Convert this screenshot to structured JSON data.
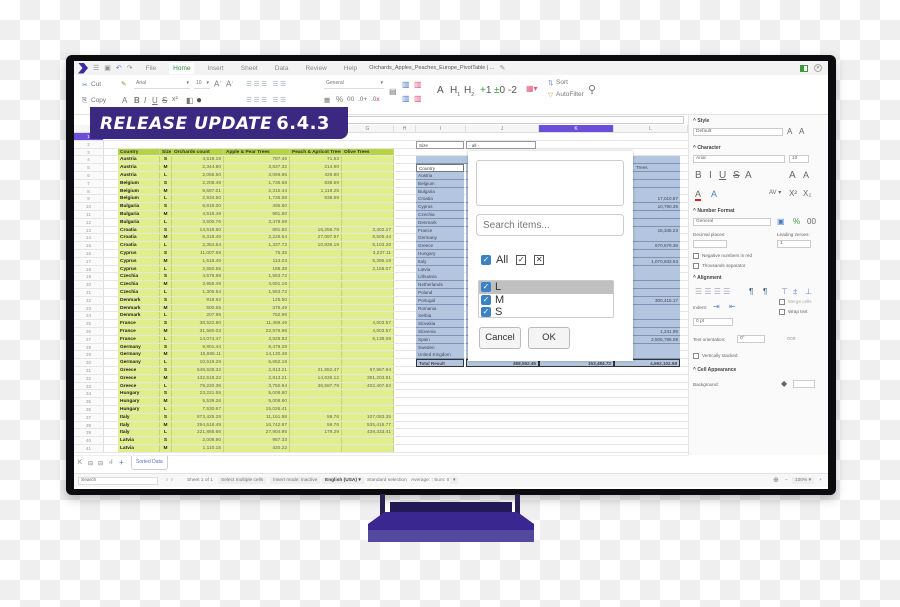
{
  "banner": {
    "text": "RELEASE UPDATE",
    "version": "6.4.3"
  },
  "menubar": {
    "tabs": [
      "File",
      "Home",
      "Insert",
      "Sheet",
      "Data",
      "Review",
      "Help"
    ],
    "active_tab": "Home",
    "document_title": "Orchards_Apples_Peaches_Europe_PivotTable | ..."
  },
  "toolbar": {
    "cut": "Cut",
    "copy": "Copy",
    "font_name": "Arial",
    "font_size": "10",
    "number_format": "General",
    "percent": "%",
    "decimals": ".00",
    "add_dec": ".0",
    "rem_dec": ".00",
    "heading_a": "A",
    "heading_h1": "H1",
    "heading_h2": "H2",
    "outline_plus": "+1",
    "outline_zero": "±0",
    "outline_minus": "-2",
    "sort": "Sort",
    "autofilter": "AutoFilter"
  },
  "columns": [
    "",
    "A",
    "B",
    "C",
    "D",
    "E",
    "F",
    "G",
    "H",
    "I",
    "J",
    "K",
    "L"
  ],
  "selected_column": "K",
  "data_table": {
    "headers": [
      "Country",
      "Size",
      "Orchards count",
      "Apple & Pear Trees",
      "Peach & Apricot Trees",
      "Olive Trees"
    ],
    "rows": [
      [
        "Austria",
        "S",
        "4,518.19",
        "787.46",
        "71.63",
        ""
      ],
      [
        "Austria",
        "M",
        "2,344.80",
        "3,837.32",
        "214.90",
        ""
      ],
      [
        "Austria",
        "L",
        "2,055.50",
        "3,069.85",
        "429.80",
        ""
      ],
      [
        "Belgium",
        "S",
        "2,208.49",
        "1,736.58",
        "838.69",
        ""
      ],
      [
        "Belgium",
        "M",
        "9,587.01",
        "2,315.44",
        "1,118.25",
        ""
      ],
      [
        "Belgium",
        "L",
        "2,934.50",
        "1,736.58",
        "838.69",
        ""
      ],
      [
        "Bulgaria",
        "S",
        "6,918.00",
        "495.80",
        "",
        ""
      ],
      [
        "Bulgaria",
        "M",
        "4,518.49",
        "991.60",
        "",
        ""
      ],
      [
        "Bulgaria",
        "L",
        "3,500.76",
        "3,479.59",
        "",
        ""
      ],
      [
        "Croatia",
        "S",
        "14,518.60",
        "891.82",
        "16,256.78",
        "3,402.17"
      ],
      [
        "Croatia",
        "M",
        "6,318.49",
        "2,229.54",
        "27,097.97",
        "8,505.44"
      ],
      [
        "Croatia",
        "L",
        "2,354.64",
        "1,337.72",
        "10,839.19",
        "5,103.26"
      ],
      [
        "Cyprus",
        "S",
        "11,007.59",
        "75.35",
        "",
        "3,237.11"
      ],
      [
        "Cyprus",
        "M",
        "1,518.49",
        "113.03",
        "",
        "5,395.18"
      ],
      [
        "Cyprus",
        "L",
        "2,550.55",
        "188.38",
        "",
        "2,158.07"
      ],
      [
        "Czechia",
        "S",
        "4,578.88",
        "1,563.72",
        "",
        ""
      ],
      [
        "Czechia",
        "M",
        "3,955.49",
        "4,691.16",
        "",
        ""
      ],
      [
        "Czechia",
        "L",
        "1,306.54",
        "1,563.72",
        "",
        ""
      ],
      [
        "Denmark",
        "S",
        "918.92",
        "125.50",
        "",
        ""
      ],
      [
        "Denmark",
        "M",
        "500.65",
        "376.49",
        "",
        ""
      ],
      [
        "Denmark",
        "L",
        "207.95",
        "752.99",
        "",
        ""
      ],
      [
        "France",
        "S",
        "38,522.80",
        "11,489.49",
        "",
        "4,603.57"
      ],
      [
        "France",
        "M",
        "31,580.03",
        "22,978.98",
        "",
        "4,603.57"
      ],
      [
        "France",
        "L",
        "14,074.47",
        "3,829.83",
        "",
        "6,138.09"
      ],
      [
        "Germany",
        "S",
        "9,901.44",
        "8,479.29",
        "",
        ""
      ],
      [
        "Germany",
        "M",
        "15,698.11",
        "14,130.48",
        "",
        ""
      ],
      [
        "Germany",
        "L",
        "10,519.29",
        "5,652.19",
        "",
        ""
      ],
      [
        "Greece",
        "S",
        "549,528.32",
        "2,813.21",
        "21,952.47",
        "67,967.94"
      ],
      [
        "Greece",
        "M",
        "132,518.22",
        "2,813.21",
        "14,636.12",
        "391,203.81"
      ],
      [
        "Greece",
        "L",
        "79,220.36",
        "3,750.94",
        "36,587.79",
        "402,407.62"
      ],
      [
        "Hungary",
        "S",
        "23,221.55",
        "5,008.80",
        "",
        ""
      ],
      [
        "Hungary",
        "M",
        "5,539.26",
        "5,008.80",
        "",
        ""
      ],
      [
        "Hungary",
        "L",
        "7,530.67",
        "15,026.41",
        "",
        ""
      ],
      [
        "Italy",
        "S",
        "873,425.28",
        "11,161.98",
        "59.76",
        "107,083.35"
      ],
      [
        "Italy",
        "M",
        "294,518.49",
        "16,742.97",
        "59.76",
        "535,416.77"
      ],
      [
        "Italy",
        "L",
        "221,885.66",
        "27,904.95",
        "179.29",
        "428,333.41"
      ],
      [
        "Latvia",
        "S",
        "2,008.90",
        "957.33",
        "",
        ""
      ],
      [
        "Latvia",
        "M",
        "1,110.15",
        "420.22",
        "",
        ""
      ]
    ]
  },
  "pivot": {
    "filter_label": "Size",
    "filter_value": "- all -",
    "row_field": "Country",
    "value_header": "Trees",
    "countries": [
      "Austria",
      "Belgium",
      "Bulgaria",
      "Croatia",
      "Cyprus",
      "Czechia",
      "Denmark",
      "France",
      "Germany",
      "Greece",
      "Hungary",
      "Italy",
      "Latvia",
      "Lithuania",
      "Netherlands",
      "Poland",
      "Portugal",
      "Romania",
      "Serbia",
      "Slovakia",
      "Slovenia",
      "Spain",
      "Sweden",
      "United Kingdom"
    ],
    "last_col_values": [
      "",
      "",
      "",
      "17,010.87",
      "10,790.35",
      "",
      "",
      "15,345.23",
      "",
      "670,679.38",
      "",
      "1,070,833.53",
      "",
      "",
      "",
      "",
      "300,415.17",
      "",
      "",
      "",
      "1,241.99",
      "2,505,786.08",
      "",
      ""
    ],
    "total_label": "Total Result",
    "totals": [
      "488,552.45",
      "153,484.72",
      "4,592,102.58"
    ]
  },
  "filter_popup": {
    "search_placeholder": "Search items...",
    "all_label": "All",
    "items": [
      "L",
      "M",
      "S"
    ],
    "cancel": "Cancel",
    "ok": "OK"
  },
  "sidebar": {
    "style": {
      "title": "Style",
      "value": "Default"
    },
    "character": {
      "title": "Character",
      "font": "Arial",
      "size": "10"
    },
    "number_format": {
      "title": "Number Format",
      "value": "General",
      "decimal_label": "Decimal places:",
      "leading_label": "Leading zeroes:",
      "leading_value": "1",
      "negative_red": "Negative numbers in red",
      "thousands": "Thousands separator"
    },
    "alignment": {
      "title": "Alignment",
      "indent": "Indent:",
      "indent_value": "0 pt",
      "merge": "Merge cells",
      "wrap": "Wrap text",
      "orientation_label": "Text orientation:",
      "orientation_value": "0°",
      "vertical": "Vertically stacked"
    },
    "cell_appearance": {
      "title": "Cell Appearance",
      "background": "Background:"
    }
  },
  "sheet_tabs": [
    "Sorted Data"
  ],
  "statusbar": {
    "search_placeholder": "Search",
    "sheet": "Sheet 1 of 1",
    "select_mode": "Select multiple cells",
    "insert_mode": "Insert mode: inactive",
    "language": "English (USA)",
    "selection": "Standard selection",
    "sum": "Average: ; Sum: 0",
    "zoom": "100%"
  }
}
